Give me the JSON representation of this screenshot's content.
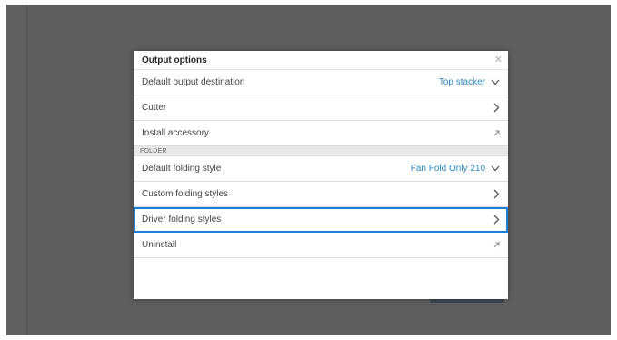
{
  "dialog": {
    "title": "Output options",
    "close_icon": "close-icon"
  },
  "rows": [
    {
      "label": "Default output destination",
      "value": "Top stacker",
      "icon": "chevron-down-icon"
    },
    {
      "label": "Cutter",
      "icon": "chevron-right-icon"
    },
    {
      "label": "Install accessory",
      "icon": "external-arrow-icon"
    }
  ],
  "folder_section": {
    "header": "FOLDER",
    "rows": [
      {
        "label": "Default folding style",
        "value": "Fan Fold Only 210",
        "icon": "chevron-down-icon"
      },
      {
        "label": "Custom folding styles",
        "icon": "chevron-right-icon"
      },
      {
        "label": "Driver folding styles",
        "icon": "chevron-right-icon",
        "selected": true
      },
      {
        "label": "Uninstall",
        "icon": "external-arrow-icon"
      }
    ]
  },
  "colors": {
    "value_text": "#2a8ac0",
    "selection_border": "#1e7fd9",
    "screen_background": "#5e5e5e"
  }
}
